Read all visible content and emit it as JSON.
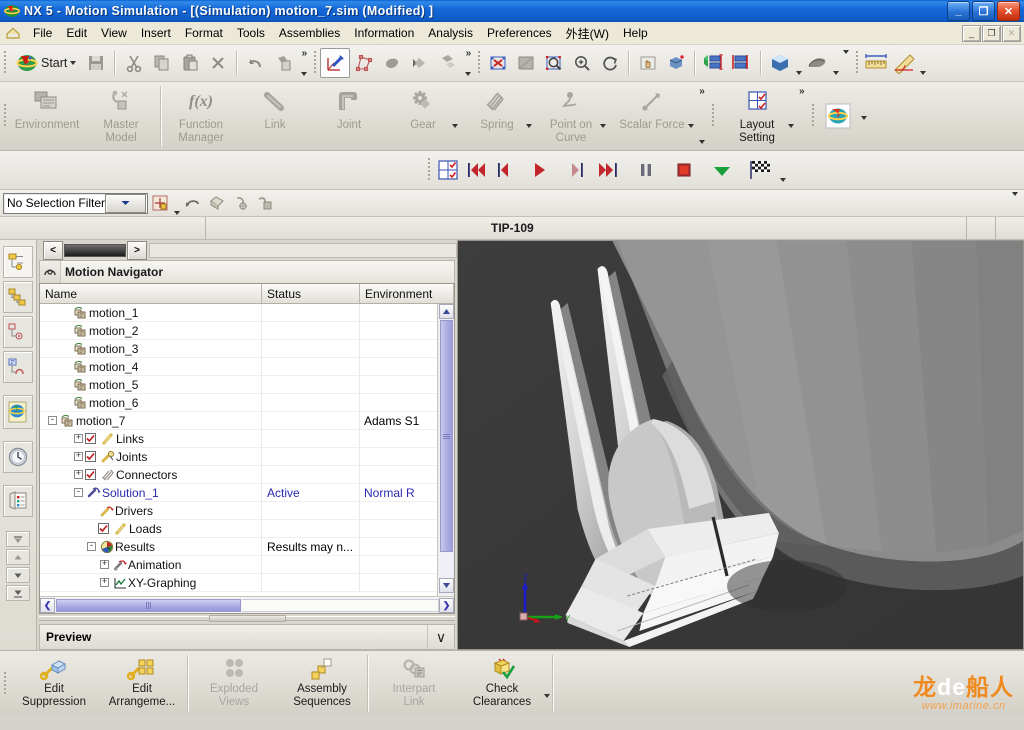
{
  "window": {
    "title": "NX 5 - Motion Simulation - [(Simulation) motion_7.sim (Modified) ]",
    "app_icon": "nx-globe-icon",
    "buttons": {
      "minimize": "_",
      "maximize": "❐",
      "close": "✕"
    }
  },
  "menubar": {
    "home_icon": "home-icon",
    "items": [
      {
        "label": "File"
      },
      {
        "label": "Edit"
      },
      {
        "label": "View"
      },
      {
        "label": "Insert"
      },
      {
        "label": "Format"
      },
      {
        "label": "Tools"
      },
      {
        "label": "Assemblies"
      },
      {
        "label": "Information"
      },
      {
        "label": "Analysis"
      },
      {
        "label": "Preferences"
      },
      {
        "label": "外挂(W)"
      },
      {
        "label": "Help"
      }
    ],
    "doc_buttons": {
      "minimize": "_",
      "restore": "❐",
      "close": "✕"
    }
  },
  "standard_toolbar": {
    "start_label": "Start",
    "items": [
      {
        "name": "start-menu-button",
        "label": "Start"
      },
      {
        "name": "save-button",
        "label": "Save"
      },
      {
        "name": "cut-button",
        "label": "Cut"
      },
      {
        "name": "copy-button",
        "label": "Copy"
      },
      {
        "name": "paste-button",
        "label": "Paste"
      },
      {
        "name": "delete-button",
        "label": "Delete"
      },
      {
        "name": "undo-button",
        "label": "Undo"
      },
      {
        "name": "redo-button",
        "label": "Redo"
      },
      {
        "name": "wcs-dynamics-button",
        "label": "WCS Dynamics"
      },
      {
        "name": "point-constructor-button",
        "label": "Point Constructor"
      },
      {
        "name": "hide-button",
        "label": "Hide"
      },
      {
        "name": "show-hide-button",
        "label": "Show and Hide"
      },
      {
        "name": "move-object-button",
        "label": "Move Object"
      },
      {
        "name": "fit-button",
        "label": "Fit"
      },
      {
        "name": "zoom-window-button",
        "label": "Zoom Window"
      },
      {
        "name": "zoom-button",
        "label": "Zoom"
      },
      {
        "name": "rotate-button",
        "label": "Rotate"
      },
      {
        "name": "pan-button",
        "label": "Pan"
      },
      {
        "name": "perspective-button",
        "label": "Perspective"
      },
      {
        "name": "true-shading-button",
        "label": "True Shading"
      },
      {
        "name": "edit-section-button",
        "label": "Edit Section"
      },
      {
        "name": "render-style-button",
        "label": "Render Style"
      },
      {
        "name": "visualization-button",
        "label": "Visualization"
      },
      {
        "name": "measure-distance-button",
        "label": "Measure Distance"
      },
      {
        "name": "measure-angle-button",
        "label": "Measure Angle"
      }
    ]
  },
  "ribbon": {
    "items": [
      {
        "label": "Environment",
        "icon": "environment-icon",
        "enabled": false,
        "dropdown": false
      },
      {
        "label": "Master\nModel",
        "label_l1": "Master",
        "label_l2": "Model",
        "icon": "master-model-icon",
        "enabled": false,
        "dropdown": false
      },
      {
        "label": "Function\nManager",
        "label_l1": "Function",
        "label_l2": "Manager",
        "icon": "fx-icon",
        "enabled": false,
        "dropdown": false
      },
      {
        "label": "Link",
        "icon": "link-icon",
        "enabled": false,
        "dropdown": false
      },
      {
        "label": "Joint",
        "icon": "joint-icon",
        "enabled": false,
        "dropdown": false
      },
      {
        "label": "Gear",
        "icon": "gear-icon",
        "enabled": false,
        "dropdown": true
      },
      {
        "label": "Spring",
        "icon": "spring-icon",
        "enabled": false,
        "dropdown": true
      },
      {
        "label": "Point on\nCurve",
        "label_l1": "Point on",
        "label_l2": "Curve",
        "icon": "point-on-curve-icon",
        "enabled": false,
        "dropdown": true
      },
      {
        "label": "Scalar Force",
        "icon": "scalar-force-icon",
        "enabled": false,
        "dropdown": true
      }
    ],
    "layout_setting": {
      "label_l1": "Layout",
      "label_l2": "Setting",
      "icon": "layout-grid-icon",
      "enabled": true
    },
    "overflow_glyph": "»"
  },
  "animation_toolbar": {
    "items": [
      {
        "name": "layout-setting-button",
        "icon": "layout-grid-icon"
      },
      {
        "name": "first-frame-button",
        "icon": "skip-back-icon"
      },
      {
        "name": "previous-frame-button",
        "icon": "step-back-icon"
      },
      {
        "name": "play-button",
        "icon": "play-icon"
      },
      {
        "name": "next-frame-button",
        "icon": "step-forward-icon"
      },
      {
        "name": "last-frame-button",
        "icon": "skip-forward-icon"
      },
      {
        "name": "pause-button",
        "icon": "pause-icon"
      },
      {
        "name": "stop-button",
        "icon": "stop-icon"
      },
      {
        "name": "export-button",
        "icon": "green-down-arrow-icon"
      },
      {
        "name": "finish-button",
        "icon": "checkered-flag-icon"
      }
    ]
  },
  "selection_bar": {
    "filter_value": "No Selection Filter",
    "filter_options": [
      "No Selection Filter"
    ],
    "items": [
      {
        "name": "selection-scope-button",
        "icon": "snap-point-icon"
      },
      {
        "name": "up-one-level-button",
        "icon": "up-level-icon"
      },
      {
        "name": "select-face-button",
        "icon": "face-select-icon"
      },
      {
        "name": "select-point-button",
        "icon": "point-select-icon"
      },
      {
        "name": "select-edge-button",
        "icon": "edge-select-icon"
      }
    ]
  },
  "tip_bar": {
    "text": "TIP-109"
  },
  "resource_bar": {
    "items": [
      {
        "name": "assembly-navigator-icon",
        "label": "Assembly Navigator"
      },
      {
        "name": "part-navigator-icon",
        "label": "Part Navigator"
      },
      {
        "name": "reuse-library-icon",
        "label": "Reuse Library"
      },
      {
        "name": "motion-navigator-icon",
        "label": "Motion Navigator"
      },
      {
        "name": "internet-explorer-icon",
        "label": "Web Browser"
      },
      {
        "name": "history-icon",
        "label": "History"
      },
      {
        "name": "roles-icon",
        "label": "Roles"
      }
    ],
    "nav_buttons": [
      "⤒",
      "▲",
      "▼",
      "⤓"
    ]
  },
  "navigator": {
    "panel_title": "Motion Navigator",
    "panel_icon": "motion-navigator-icon",
    "tab_prev": "<",
    "tab_next": ">",
    "columns": [
      "Name",
      "Status",
      "Environment"
    ],
    "rows": [
      {
        "indent": 1,
        "expander": "",
        "check": null,
        "icon": "motion-sim-icon",
        "name": "motion_1",
        "status": "",
        "environment": "",
        "blue": false
      },
      {
        "indent": 1,
        "expander": "",
        "check": null,
        "icon": "motion-sim-icon",
        "name": "motion_2",
        "status": "",
        "environment": "",
        "blue": false
      },
      {
        "indent": 1,
        "expander": "",
        "check": null,
        "icon": "motion-sim-icon",
        "name": "motion_3",
        "status": "",
        "environment": "",
        "blue": false
      },
      {
        "indent": 1,
        "expander": "",
        "check": null,
        "icon": "motion-sim-icon",
        "name": "motion_4",
        "status": "",
        "environment": "",
        "blue": false
      },
      {
        "indent": 1,
        "expander": "",
        "check": null,
        "icon": "motion-sim-icon",
        "name": "motion_5",
        "status": "",
        "environment": "",
        "blue": false
      },
      {
        "indent": 1,
        "expander": "",
        "check": null,
        "icon": "motion-sim-icon",
        "name": "motion_6",
        "status": "",
        "environment": "",
        "blue": false
      },
      {
        "indent": 0,
        "expander": "-",
        "check": null,
        "icon": "motion-sim-icon",
        "name": "motion_7",
        "status": "",
        "environment": "Adams S1",
        "blue": false
      },
      {
        "indent": 2,
        "expander": "+",
        "check": true,
        "icon": "links-icon",
        "name": "Links",
        "status": "",
        "environment": "",
        "blue": false
      },
      {
        "indent": 2,
        "expander": "+",
        "check": true,
        "icon": "joints-icon",
        "name": "Joints",
        "status": "",
        "environment": "",
        "blue": false
      },
      {
        "indent": 2,
        "expander": "+",
        "check": true,
        "icon": "connectors-icon",
        "name": "Connectors",
        "status": "",
        "environment": "",
        "blue": false
      },
      {
        "indent": 2,
        "expander": "-",
        "check": null,
        "icon": "solution-icon",
        "name": "Solution_1",
        "status": "Active",
        "environment": "Normal R",
        "blue": true
      },
      {
        "indent": 3,
        "expander": "",
        "check": null,
        "icon": "drivers-icon",
        "name": "Drivers",
        "status": "",
        "environment": "",
        "blue": false
      },
      {
        "indent": 3,
        "expander": "",
        "check": true,
        "icon": "loads-icon",
        "name": "Loads",
        "status": "",
        "environment": "",
        "blue": false
      },
      {
        "indent": 3,
        "expander": "-",
        "check": null,
        "icon": "results-icon",
        "name": "Results",
        "status": "Results may n...",
        "environment": "",
        "blue": false
      },
      {
        "indent": 4,
        "expander": "+",
        "check": null,
        "icon": "animation-icon",
        "name": "Animation",
        "status": "",
        "environment": "",
        "blue": false
      },
      {
        "indent": 4,
        "expander": "+",
        "check": null,
        "icon": "xy-graphing-icon",
        "name": "XY-Graphing",
        "status": "",
        "environment": "",
        "blue": false
      }
    ],
    "hscroll": {
      "left": "❮",
      "right": "❯"
    },
    "vscroll": {
      "up": "︿",
      "down": "﹀"
    }
  },
  "preview": {
    "label": "Preview",
    "chevron": "∨"
  },
  "viewport": {
    "triad": {
      "z": "Z",
      "y": "Y",
      "x": "X"
    },
    "background": "#3b3b3b"
  },
  "bottom_toolbar": {
    "items": [
      {
        "name": "edit-suppression-button",
        "l1": "Edit",
        "l2": "Suppression",
        "icon": "edit-suppression-icon",
        "enabled": true
      },
      {
        "name": "edit-arrangements-button",
        "l1": "Edit",
        "l2": "Arrangeme...",
        "icon": "edit-arrangements-icon",
        "enabled": true
      },
      {
        "name": "exploded-views-button",
        "l1": "Exploded",
        "l2": "Views",
        "icon": "exploded-views-icon",
        "enabled": false
      },
      {
        "name": "assembly-sequences-button",
        "l1": "Assembly",
        "l2": "Sequences",
        "icon": "assembly-sequences-icon",
        "enabled": true
      },
      {
        "name": "interpart-link-button",
        "l1": "Interpart",
        "l2": "Link",
        "icon": "interpart-link-icon",
        "enabled": false
      },
      {
        "name": "check-clearances-button",
        "l1": "Check",
        "l2": "Clearances",
        "icon": "check-clearances-icon",
        "enabled": true
      }
    ]
  },
  "watermark": {
    "line1_a": "龙",
    "line1_b": "de",
    "line1_c": "船人",
    "line2": "www.imarine.cn"
  },
  "colors": {
    "titlebar_blue": "#1567d8",
    "tree_link_blue": "#2a2ab0",
    "accent_orange": "#f08a1e",
    "viewport_bg": "#3b3b3b",
    "chrome_gray": "#d6d3ce"
  }
}
